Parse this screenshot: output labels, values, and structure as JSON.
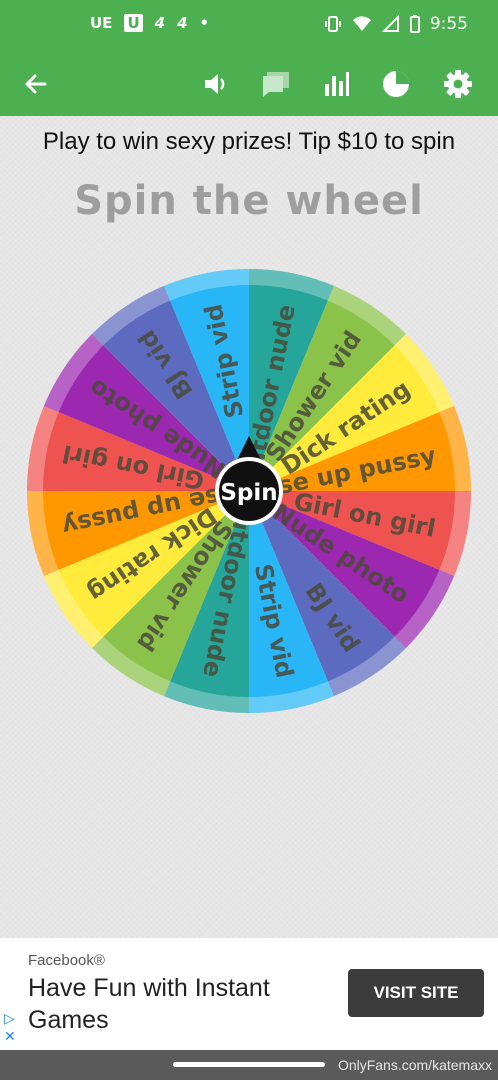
{
  "status_bar": {
    "left_items": [
      "UE",
      "U",
      "4",
      "4",
      "•"
    ],
    "time": "9:55"
  },
  "app_bar": {
    "icons": [
      "back-arrow-icon",
      "volume-icon",
      "chat-icon",
      "stats-icon",
      "pie-chart-icon",
      "settings-icon"
    ]
  },
  "prompt_text": "Play to win sexy prizes! Tip $10 to spin",
  "title": "Spin the wheel",
  "wheel": {
    "center_label": "Spin",
    "segments": [
      {
        "label": "Outdoor nude",
        "color": "#26a69a"
      },
      {
        "label": "Shower vid",
        "color": "#8bc34a"
      },
      {
        "label": "Dick rating",
        "color": "#ffeb3b"
      },
      {
        "label": "Close up pussy",
        "color": "#ff9800"
      },
      {
        "label": "Girl on girl",
        "color": "#ef5350"
      },
      {
        "label": "Nude photo",
        "color": "#9c27b0"
      },
      {
        "label": "BJ vid",
        "color": "#5c6bc0"
      },
      {
        "label": "Strip vid",
        "color": "#29b6f6"
      },
      {
        "label": "Outdoor nude",
        "color": "#26a69a"
      },
      {
        "label": "Shower vid",
        "color": "#8bc34a"
      },
      {
        "label": "Dick rating",
        "color": "#ffeb3b"
      },
      {
        "label": "Close up pussy",
        "color": "#ff9800"
      },
      {
        "label": "Girl on girl",
        "color": "#ef5350"
      },
      {
        "label": "Nude photo",
        "color": "#9c27b0"
      },
      {
        "label": "BJ vid",
        "color": "#5c6bc0"
      },
      {
        "label": "Strip vid",
        "color": "#29b6f6"
      }
    ]
  },
  "ad": {
    "sponsor": "Facebook®",
    "headline": "Have Fun with Instant Games",
    "cta": "VISIT SITE"
  },
  "watermark": "OnlyFans.com/katemaxx"
}
